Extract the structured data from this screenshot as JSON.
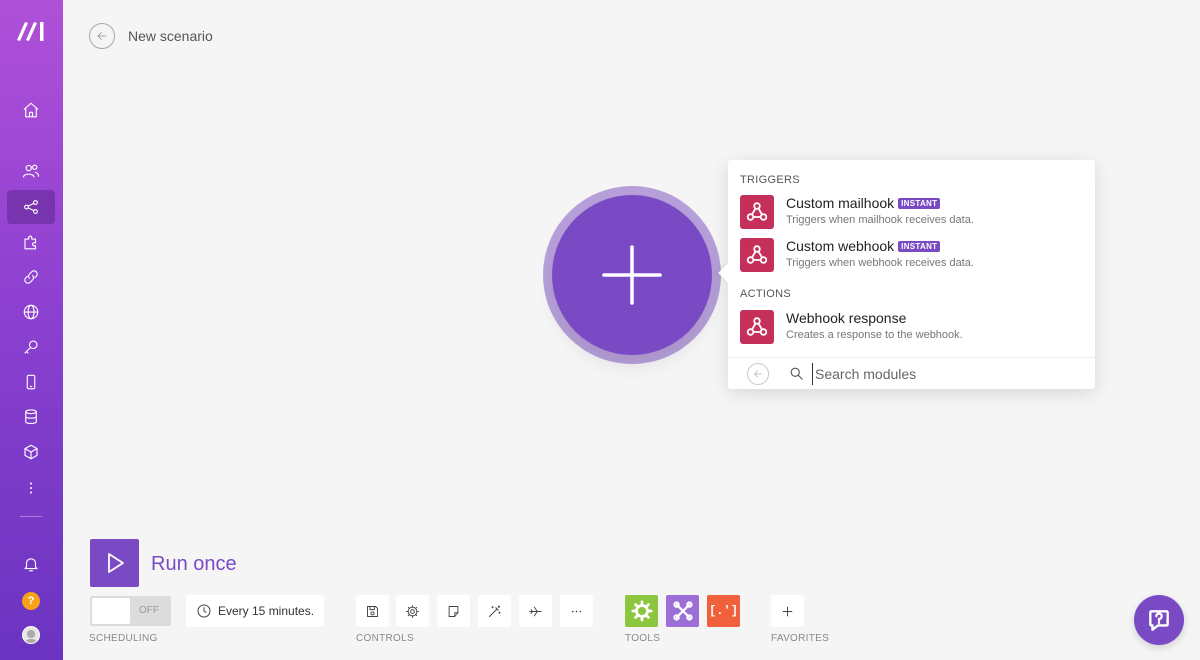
{
  "header": {
    "title": "New scenario"
  },
  "sidebar": {
    "help_mark": "?",
    "items": [
      {
        "icon": "home-icon"
      },
      {
        "icon": "team-icon"
      },
      {
        "icon": "scenarios-icon",
        "active": true
      },
      {
        "icon": "templates-puzzle-icon"
      },
      {
        "icon": "connections-link-icon"
      },
      {
        "icon": "webhooks-globe-icon"
      },
      {
        "icon": "keys-icon"
      },
      {
        "icon": "devices-phone-icon"
      },
      {
        "icon": "data-stores-icon"
      },
      {
        "icon": "data-structures-box-icon"
      },
      {
        "icon": "more-vertical-icon"
      },
      {
        "icon": "notifications-bell-icon"
      }
    ]
  },
  "module_picker": {
    "triggers_label": "TRIGGERS",
    "actions_label": "ACTIONS",
    "badge_text": "INSTANT",
    "triggers": [
      {
        "name": "Custom mailhook",
        "badge": "INSTANT",
        "description": "Triggers when mailhook receives data."
      },
      {
        "name": "Custom webhook",
        "badge": "INSTANT",
        "description": "Triggers when webhook receives data."
      }
    ],
    "actions": [
      {
        "name": "Webhook response",
        "description": "Creates a response to the webhook."
      }
    ],
    "search": {
      "placeholder": "Search modules",
      "value": ""
    }
  },
  "toolbar": {
    "run_label": "Run once",
    "toggle_state": "OFF",
    "schedule_text": "Every 15 minutes.",
    "scheduling_label": "SCHEDULING",
    "controls_label": "CONTROLS",
    "tools_label": "TOOLS",
    "favorites_label": "FAVORITES",
    "controls": [
      "save-icon",
      "settings-gear-icon",
      "notes-icon",
      "auto-align-wand-icon",
      "explain-flow-plane-icon",
      "more-horizontal-icon"
    ],
    "tools": [
      {
        "icon": "flow-control-gear-icon",
        "color": "#8cc63f"
      },
      {
        "icon": "tools-icon",
        "color": "#9b6fd6"
      },
      {
        "icon": "text-parser-icon",
        "color": "#f0603b",
        "text": "[.']"
      }
    ]
  },
  "colors": {
    "accent": "#7a4ac4",
    "webhook_module": "#c4305a",
    "help_orange": "#f7a21b"
  }
}
